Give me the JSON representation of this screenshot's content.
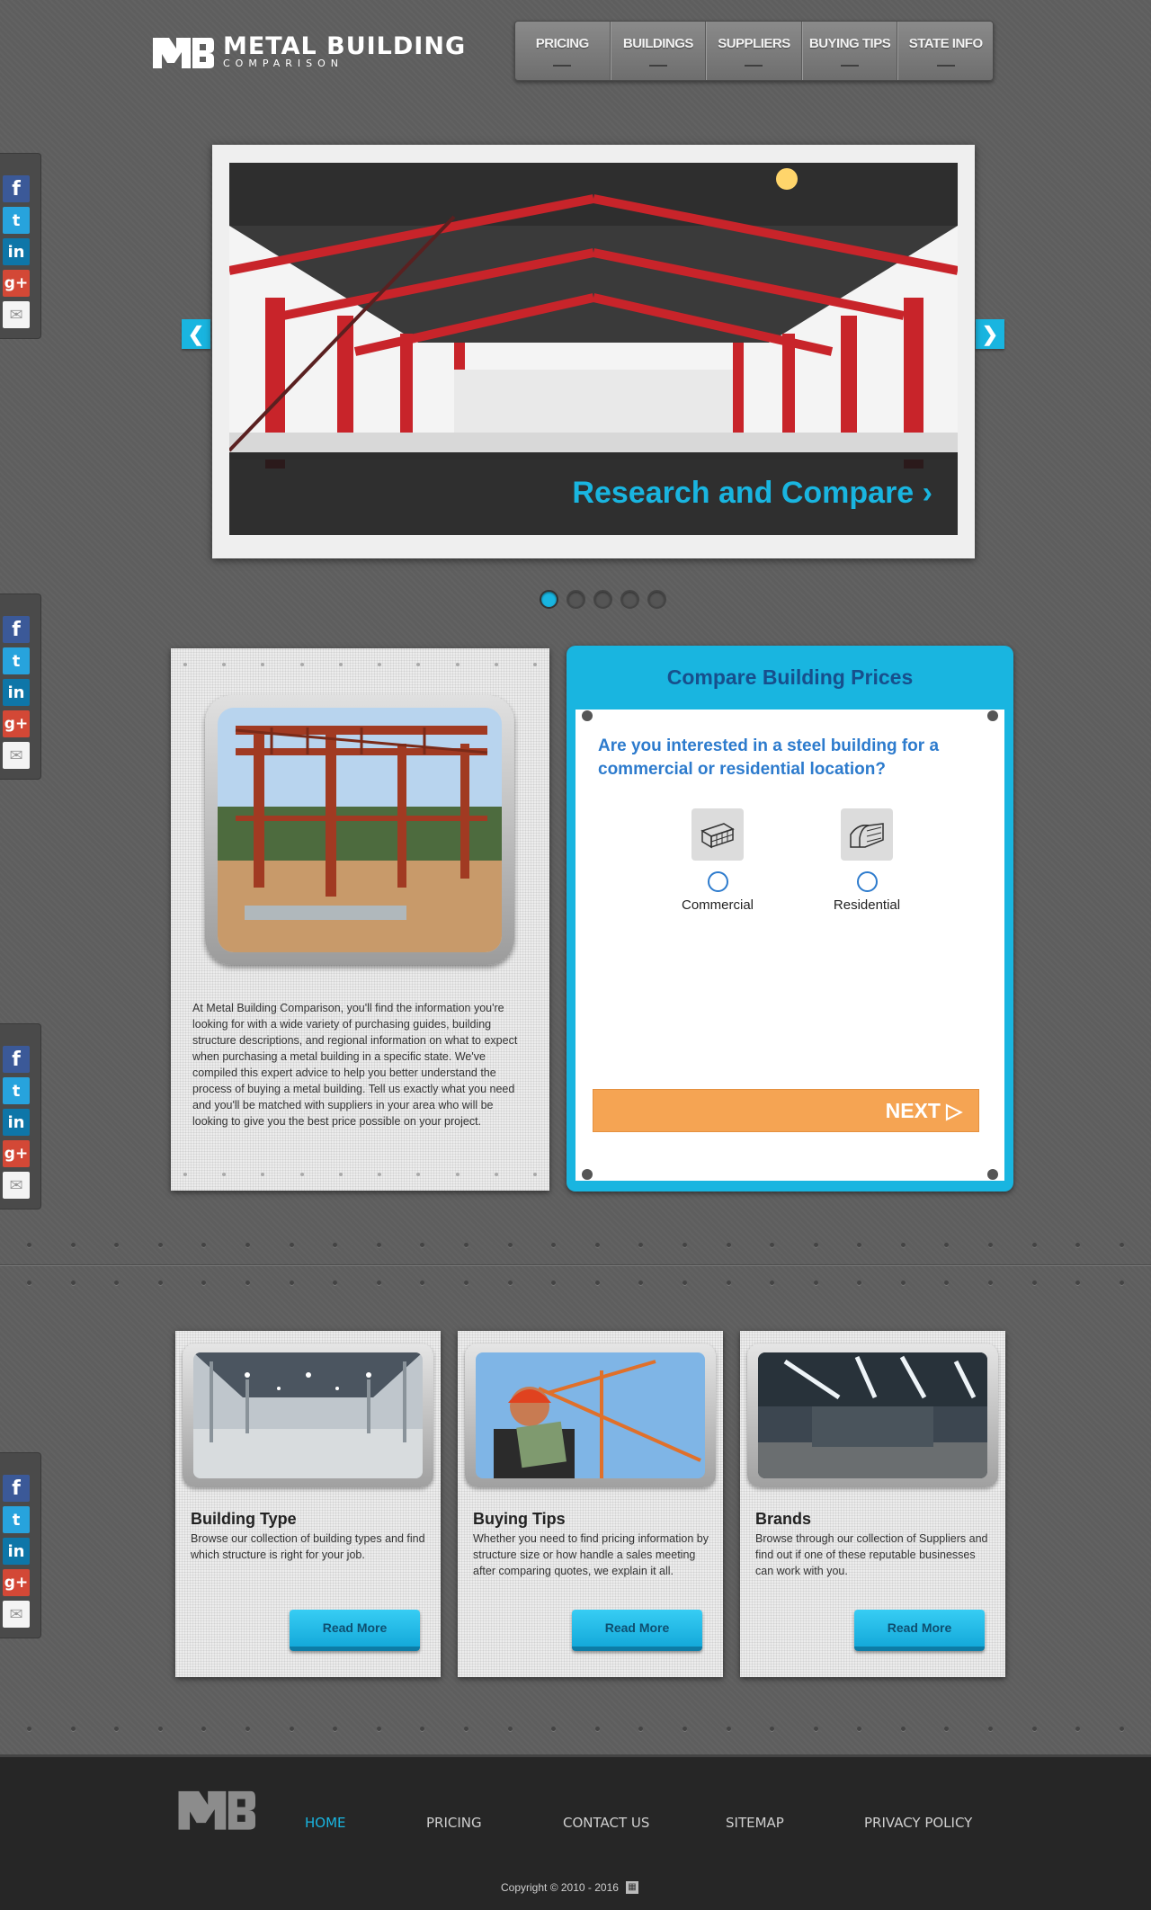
{
  "logo": {
    "main": "METAL BUILDING",
    "sub": "COMPARISON"
  },
  "nav": [
    "PRICING",
    "BUILDINGS",
    "SUPPLIERS",
    "BUYING TIPS",
    "STATE INFO"
  ],
  "social": {
    "facebook": "f",
    "twitter": "t",
    "linkedin": "in",
    "googleplus": "g+",
    "email": "✉"
  },
  "slider": {
    "caption": "Research and Compare ›",
    "prev": "❮",
    "next": "❯",
    "slide_count": 5,
    "active_slide": 1
  },
  "intro": {
    "text": "At Metal Building Comparison, you'll find the information you're looking for with a wide variety of purchasing guides, building structure descriptions, and regional information on what to expect when purchasing a metal building in a specific state. We've compiled this expert advice to help you better understand the process of buying a metal building. Tell us exactly what you need and you'll be matched with suppliers in your area who will be looking to give you the best price possible on your project."
  },
  "compare": {
    "title": "Compare Building Prices",
    "question": "Are you interested in a steel building for a commercial or residential location?",
    "options": [
      {
        "label": "Commercial",
        "icon": "commercial-building-icon"
      },
      {
        "label": "Residential",
        "icon": "residential-building-icon"
      }
    ],
    "next": "NEXT ▷"
  },
  "cards": [
    {
      "title": "Building Type",
      "text": "Browse our collection of building types and find which structure is right for your job.",
      "button": "Read More"
    },
    {
      "title": "Buying Tips",
      "text": "Whether you need to find pricing information by structure size or how handle a sales meeting after comparing quotes, we explain it all.",
      "button": "Read More"
    },
    {
      "title": "Brands",
      "text": "Browse through our collection of Suppliers and find out if one of these reputable businesses can work with you.",
      "button": "Read More"
    }
  ],
  "footer": {
    "nav": [
      "HOME",
      "PRICING",
      "CONTACT US",
      "SITEMAP",
      "PRIVACY POLICY"
    ],
    "active": "HOME",
    "copyright": "Copyright © 2010 - 2016"
  },
  "colors": {
    "accent": "#19b5e0",
    "title_blue": "#174f8c",
    "question_blue": "#2d7bcd",
    "next_orange": "#f5a453"
  }
}
